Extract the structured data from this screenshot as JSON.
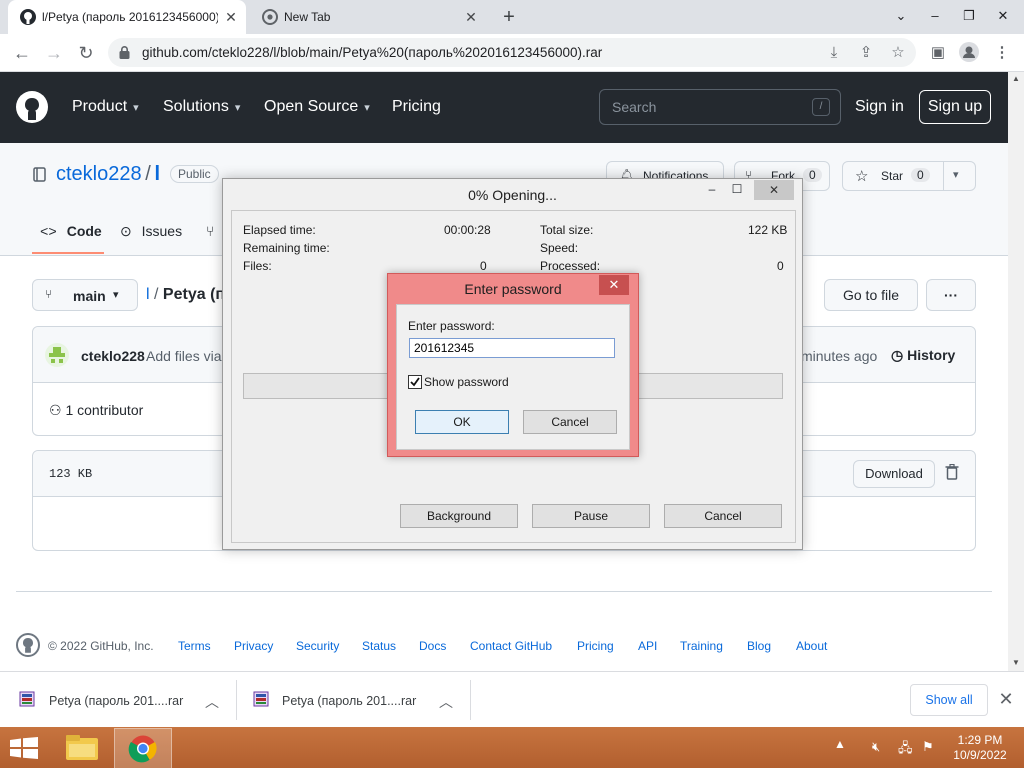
{
  "browser": {
    "tabs": [
      {
        "title": "l/Petya (пароль 2016123456000)",
        "active": true
      },
      {
        "title": "New Tab",
        "active": false
      }
    ],
    "url": "github.com/cteklo228/l/blob/main/Petya%20(пароль%202016123456000).rar"
  },
  "github": {
    "nav": [
      "Product",
      "Solutions",
      "Open Source",
      "Pricing"
    ],
    "search_placeholder": "Search",
    "search_shortcut": "/",
    "sign_in": "Sign in",
    "sign_up": "Sign up",
    "repo_owner": "cteklo228",
    "repo_sep": "/",
    "repo_name": "l",
    "visibility": "Public",
    "notifications_label": "Notifications",
    "fork_label": "Fork",
    "fork_count": "0",
    "star_label": "Star",
    "star_count": "0",
    "tabs": [
      "Code",
      "Issues"
    ],
    "branch": "main",
    "breadcrumb_repo": "l",
    "breadcrumb_sep": "/",
    "breadcrumb_file": "Petya (п",
    "go_to_file": "Go to file",
    "more": "···",
    "commit_author": "cteklo228",
    "commit_message": "Add files via",
    "commit_time": "minutes ago",
    "history": "History",
    "contributors": "1 contributor",
    "file_size": "123 KB",
    "download": "Download"
  },
  "footer": {
    "copyright": "© 2022 GitHub, Inc.",
    "links": [
      "Terms",
      "Privacy",
      "Security",
      "Status",
      "Docs",
      "Contact GitHub",
      "Pricing",
      "API",
      "Training",
      "Blog",
      "About"
    ]
  },
  "progress_dialog": {
    "title": "0% Opening...",
    "elapsed_label": "Elapsed time:",
    "elapsed_value": "00:00:28",
    "remaining_label": "Remaining time:",
    "files_label": "Files:",
    "files_value": "0",
    "total_size_label": "Total size:",
    "total_size_value": "122 KB",
    "speed_label": "Speed:",
    "processed_label": "Processed:",
    "processed_value": "0",
    "progress": 0,
    "buttons": [
      "Background",
      "Pause",
      "Cancel"
    ]
  },
  "password_dialog": {
    "title": "Enter password",
    "prompt": "Enter password:",
    "value": "201612345",
    "show_password_label": "Show password",
    "show_password_checked": true,
    "ok": "OK",
    "cancel": "Cancel"
  },
  "downloads": {
    "items": [
      "Petya (пароль 201....rar",
      "Petya (пароль 201....rar"
    ],
    "show_all": "Show all"
  },
  "taskbar": {
    "time": "1:29 PM",
    "date": "10/9/2022"
  },
  "colors": {
    "github_header": "#24292f",
    "link": "#0969da",
    "password_dialog_frame": "#f08a8a",
    "taskbar": "#b25f2f"
  }
}
